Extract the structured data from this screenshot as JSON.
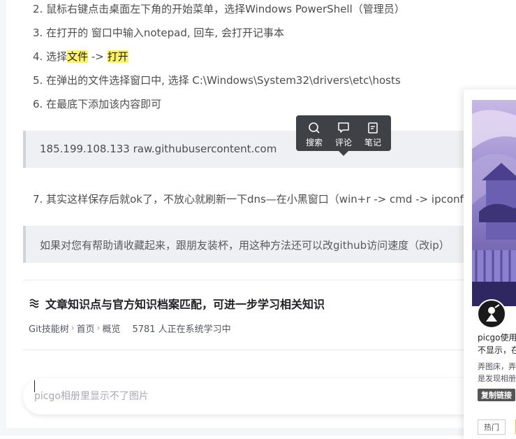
{
  "steps": [
    {
      "num": "2.",
      "text": "鼠标右键点击桌面左下角的开始菜单，选择Windows PowerShell（管理员）"
    },
    {
      "num": "3.",
      "text": "在打开的 窗口中输入notepad, 回车, 会打开记事本"
    },
    {
      "num": "4.",
      "pre": "选择",
      "hl1": "文件",
      "mid": " -> ",
      "hl2": "打开"
    },
    {
      "num": "5.",
      "text": "在弹出的文件选择窗口中, 选择 C:\\Windows\\System32\\drivers\\etc\\hosts"
    },
    {
      "num": "6.",
      "text": "在最底下添加该内容即可"
    },
    {
      "num": "7.",
      "text": "其实这样保存后就ok了，不放心就刷新一下dns—在小黑窗口（win+r -> cmd -> ipconfig /flushdns"
    }
  ],
  "code_block": {
    "text": "185.199.108.133 raw.githubusercontent.com"
  },
  "quote": {
    "text": "如果对您有帮助请收藏起来，跟朋友装杯，用这种方法还可以改github访问速度（改ip）"
  },
  "popup": {
    "search_label": "搜索",
    "comment_label": "评论",
    "note_label": "笔记"
  },
  "knowledge": {
    "title": "文章知识点与官方知识档案匹配，可进一步学习相关知识",
    "path": [
      "Git技能树",
      "首页",
      "概览"
    ],
    "count_text": "5781 人正在系统学习中"
  },
  "comment": {
    "placeholder": "picgo相册里显示不了图片"
  },
  "side_card": {
    "title_line1": "picgo使用",
    "title_line2": "不显示，在",
    "desc_line1": "弄图床，弄",
    "desc_line2": "是发现相册",
    "copy_label": "复制链接",
    "hot_label": "热门"
  },
  "colors": {
    "highlight": "#fff35f",
    "popup_bg": "#3e4247",
    "code_bg": "#eef0f4"
  }
}
